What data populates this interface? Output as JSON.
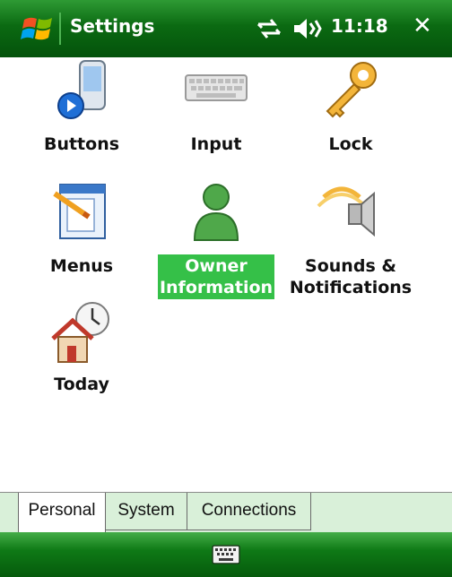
{
  "window": {
    "title": "Settings",
    "time": "11:18",
    "close_label": "✕"
  },
  "items": [
    {
      "label": "Buttons",
      "icon": "pda-buttons-icon"
    },
    {
      "label": "Input",
      "icon": "keyboard-icon"
    },
    {
      "label": "Lock",
      "icon": "key-icon"
    },
    {
      "label": "Menus",
      "icon": "menus-icon"
    },
    {
      "label": "Owner\nInformation",
      "icon": "person-icon",
      "selected": true
    },
    {
      "label": "Sounds &\nNotifications",
      "icon": "speaker-icon"
    },
    {
      "label": "Today",
      "icon": "house-clock-icon"
    }
  ],
  "tabs": [
    {
      "label": "Personal",
      "active": true
    },
    {
      "label": "System",
      "active": false
    },
    {
      "label": "Connections",
      "active": false
    }
  ],
  "colors": {
    "bar_green": "#0b6a12",
    "selection_green": "#35c048",
    "tab_bg": "#d9f0d9"
  }
}
